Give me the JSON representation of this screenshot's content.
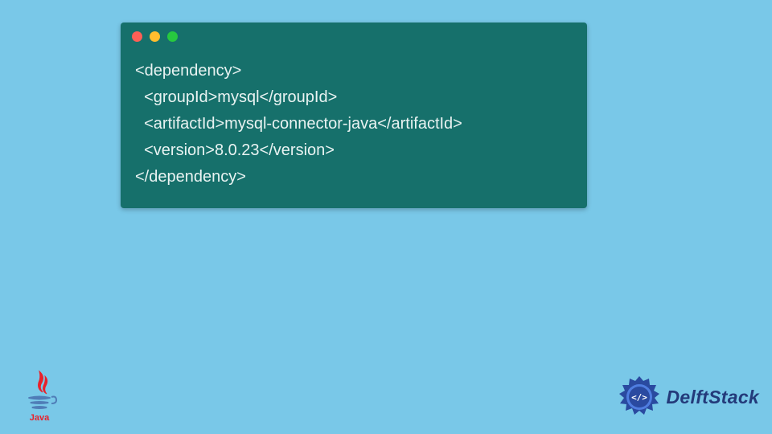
{
  "code_window": {
    "lines": [
      "<dependency>",
      "  <groupId>mysql</groupId>",
      "  <artifactId>mysql-connector-java</artifactId>",
      "  <version>8.0.23</version>",
      "</dependency>"
    ]
  },
  "logos": {
    "java_label": "Java",
    "delft_label": "DelftStack"
  },
  "colors": {
    "bg": "#79c8e8",
    "window": "#16706b",
    "text": "#e9f3f2",
    "delft_blue": "#233a7a"
  }
}
